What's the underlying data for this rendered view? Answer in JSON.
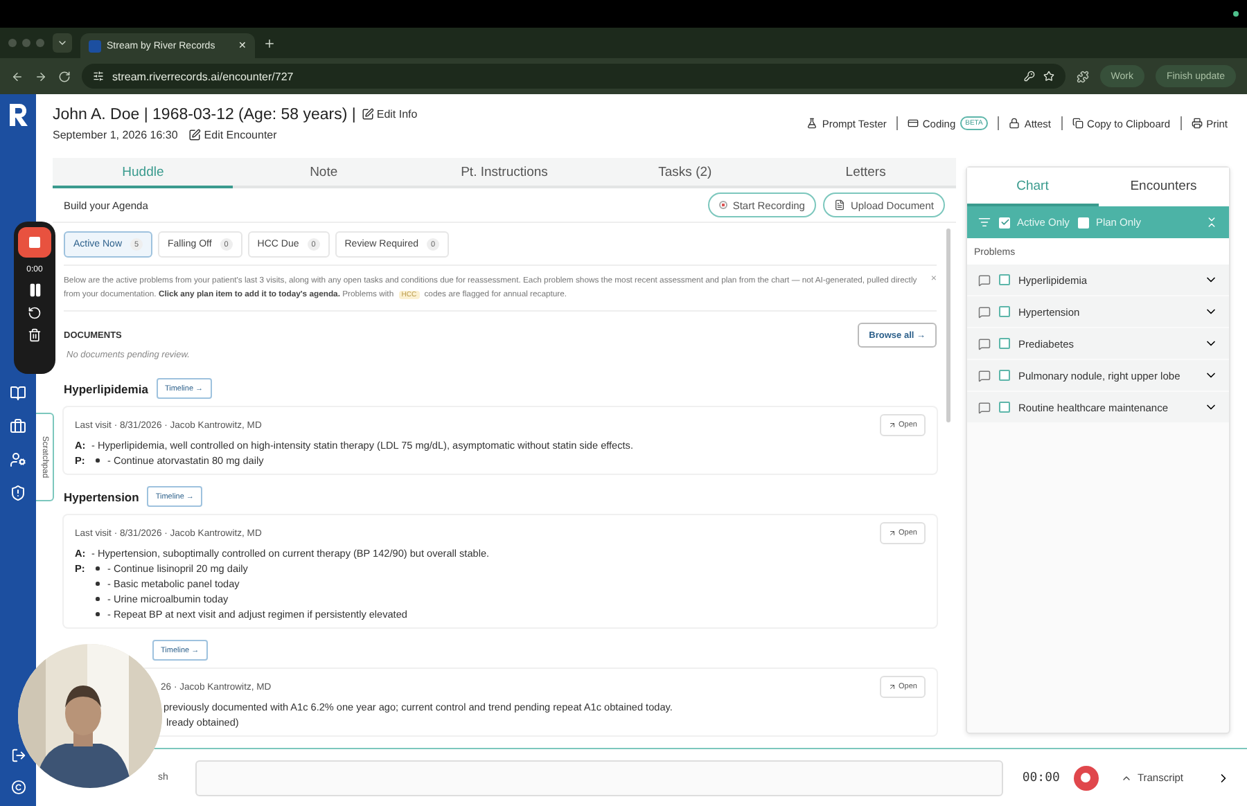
{
  "browser": {
    "tab_title": "Stream by River Records",
    "url": "stream.riverrecords.ai/encounter/727",
    "tab_close": "✕",
    "profile": "Work",
    "update": "Finish update"
  },
  "patient": {
    "name_line": "John A. Doe | 1968-03-12 (Age: 58 years) |",
    "edit_info": "Edit Info",
    "date": "September 1, 2026 16:30",
    "edit_encounter": "Edit Encounter"
  },
  "toolbar": [
    {
      "kind": "prompt",
      "label": "Prompt Tester"
    },
    {
      "kind": "coding",
      "label": "Coding",
      "badge": "BETA"
    },
    {
      "kind": "attest",
      "label": "Attest"
    },
    {
      "kind": "copy",
      "label": "Copy to Clipboard"
    },
    {
      "kind": "print",
      "label": "Print"
    }
  ],
  "tabs": [
    {
      "label": "Huddle",
      "selected": true
    },
    {
      "label": "Note",
      "selected": false
    },
    {
      "label": "Pt. Instructions",
      "selected": false
    },
    {
      "label": "Tasks (2)",
      "selected": false
    },
    {
      "label": "Letters",
      "selected": false
    }
  ],
  "agenda_title": "Build your Agenda",
  "actions": [
    {
      "kind": "record",
      "label": "Start Recording"
    },
    {
      "kind": "upload",
      "label": "Upload Document"
    }
  ],
  "filters": [
    {
      "label": "Active Now",
      "count": "5",
      "selected": true
    },
    {
      "label": "Falling Off",
      "count": "0",
      "selected": false
    },
    {
      "label": "HCC Due",
      "count": "0",
      "selected": false
    },
    {
      "label": "Review Required",
      "count": "0",
      "selected": false
    }
  ],
  "notice": {
    "text": "Below are the active problems from your patient's last 3 visits, along with any open tasks and conditions due for reassessment. Each problem shows the most recent assessment and plan from the chart — not AI-generated, pulled directly from your documentation. **Click any plan item to add it to today's agenda.** Problems with",
    "tag": "HCC",
    "text_end": "codes are flagged for annual recapture.",
    "close": "×"
  },
  "documents": {
    "heading": "DOCUMENTS",
    "empty": "No documents pending review.",
    "browse": "Browse all →"
  },
  "problems": [
    {
      "kind": "full",
      "title": "Hyperlipidemia",
      "timeline": "Timeline →",
      "visit": "Last visit · 8/31/2026 · Jacob Kantrowitz, MD",
      "open": "Open",
      "a_label": "A:",
      "p_label": "P:",
      "assessment": "- Hyperlipidemia, well controlled on high-intensity statin therapy (LDL 75 mg/dL), asymptomatic without statin side effects.",
      "plan": [
        "- Continue atorvastatin 80 mg daily"
      ]
    },
    {
      "kind": "full",
      "title": "Hypertension",
      "timeline": "Timeline →",
      "visit": "Last visit · 8/31/2026 · Jacob Kantrowitz, MD",
      "open": "Open",
      "a_label": "A:",
      "p_label": "P:",
      "assessment": "- Hypertension, suboptimally controlled on current therapy (BP 142/90) but overall stable.",
      "plan": [
        "- Continue lisinopril 20 mg daily",
        "- Basic metabolic panel today",
        "- Urine microalbumin today",
        "- Repeat BP at next visit and adjust regimen if persistently elevated"
      ]
    },
    {
      "kind": "obscured",
      "timeline": "Timeline →",
      "visit": "26 · Jacob Kantrowitz, MD",
      "open": "Open",
      "lines": [
        "previously documented with A1c 6.2% one year ago; current control and trend pending repeat A1c obtained today.",
        "lready obtained)"
      ]
    }
  ],
  "chart_panel": {
    "tabs": [
      {
        "label": "Chart",
        "selected": true
      },
      {
        "label": "Encounters",
        "selected": false
      }
    ],
    "filters": [
      {
        "label": "Active Only",
        "checked": true
      },
      {
        "label": "Plan Only",
        "checked": false
      }
    ],
    "heading": "Problems",
    "items": [
      {
        "label": "Hyperlipidemia",
        "checked": false,
        "expanded": false
      },
      {
        "label": "Hypertension",
        "checked": false,
        "expanded": false
      },
      {
        "label": "Prediabetes",
        "checked": false,
        "expanded": false
      },
      {
        "label": "Pulmonary nodule, right upper lobe",
        "checked": false,
        "expanded": false
      },
      {
        "label": "Routine healthcare maintenance",
        "checked": false,
        "expanded": false
      }
    ]
  },
  "recorder": {
    "time": "0:00"
  },
  "scratchpad": "Scratchpad",
  "bottom_bar": {
    "label": "sh",
    "timer": "00:00",
    "transcript": "Transcript"
  }
}
